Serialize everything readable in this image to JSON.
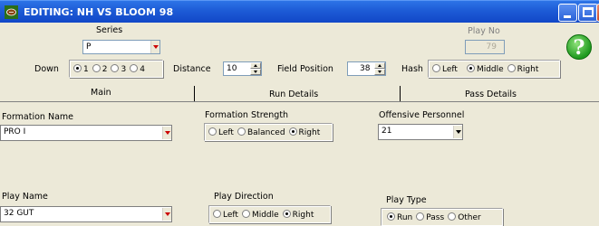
{
  "window": {
    "title": "EDITING: NH VS BLOOM 98"
  },
  "header": {
    "series_label": "Series",
    "series_value": "P",
    "playno_label": "Play No",
    "playno_value": "79",
    "down_label": "Down",
    "down_options": [
      "1",
      "2",
      "3",
      "4"
    ],
    "down_selected": "1",
    "distance_label": "Distance",
    "distance_value": "10",
    "fieldpos_label": "Field Position",
    "fieldpos_value": "38",
    "hash_label": "Hash",
    "hash_options": [
      "Left",
      "Middle",
      "Right"
    ],
    "hash_selected": "Middle"
  },
  "tabs": [
    "Main",
    "Run Details",
    "Pass Details"
  ],
  "main": {
    "formation_name_label": "Formation Name",
    "formation_name_value": "PRO I",
    "formation_strength_label": "Formation Strength",
    "formation_strength_options": [
      "Left",
      "Balanced",
      "Right"
    ],
    "formation_strength_selected": "Right",
    "offensive_personnel_label": "Offensive Personnel",
    "offensive_personnel_value": "21",
    "play_name_label": "Play Name",
    "play_name_value": "32 GUT",
    "play_direction_label": "Play Direction",
    "play_direction_options": [
      "Left",
      "Middle",
      "Right"
    ],
    "play_direction_selected": "Right",
    "play_type_label": "Play Type",
    "play_type_options": [
      "Run",
      "Pass",
      "Other"
    ],
    "play_type_selected": "Run"
  },
  "icons": {
    "help": "help-icon",
    "app": "football-icon"
  },
  "colors": {
    "titlebar": "#1d5bd6",
    "dropdown_arrow": "#cc0000",
    "help": "#1f9a1f"
  }
}
